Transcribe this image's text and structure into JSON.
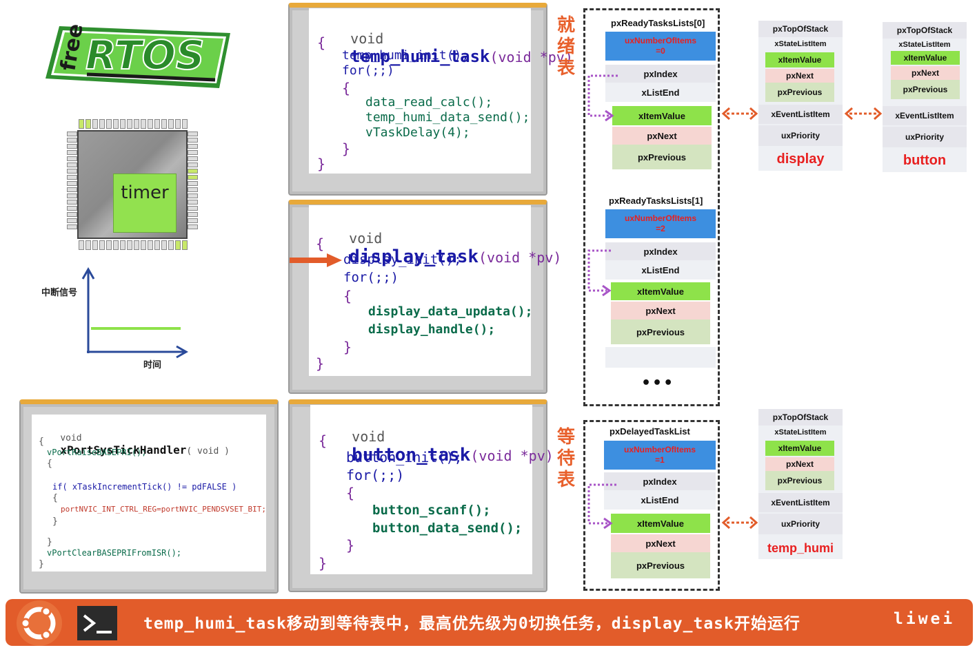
{
  "logo": {
    "free": "free",
    "rtos": "RTOS"
  },
  "chip": {
    "label": "timer"
  },
  "interrupt_plot": {
    "ylabel": "中断信号",
    "xlabel": "时间"
  },
  "tasks": {
    "temp_humi": {
      "signature_void": "void",
      "name": "temp_humi_task",
      "param": "(void *pv)",
      "lines": [
        "temp_humi_init();",
        "for(;;)",
        "data_read_calc();",
        "temp_humi_data_send();",
        "vTaskDelay(4);"
      ]
    },
    "display": {
      "signature_void": "void",
      "name": "display_task",
      "param": "(void *pv)",
      "lines": [
        "display_init();",
        "for(;;)",
        "display_data_updata();",
        "display_handle();"
      ]
    },
    "button": {
      "signature_void": "void",
      "name": "button_task",
      "param": "(void *pv)",
      "lines": [
        "button_init();",
        "for(;;)",
        "button_scanf();",
        "button_data_send();"
      ]
    },
    "systick": {
      "signature_void": "void",
      "name": "xPortSysTickHandler",
      "param": "( void )",
      "lines": [
        "vPortRaiseBASEPRI();",
        "if( xTaskIncrementTick() != pdFALSE )",
        "portNVIC_INT_CTRL_REG=portNVIC_PENDSVSET_BIT;",
        "vPortClearBASEPRIFromISR();"
      ]
    }
  },
  "labels": {
    "ready": [
      "就",
      "绪",
      "表"
    ],
    "delayed": [
      "等",
      "待",
      "表"
    ]
  },
  "lists": {
    "ready0": {
      "title": "pxReadyTasksLists[0]",
      "count_label": "uxNumberOfItems",
      "count": "=0"
    },
    "ready1": {
      "title": "pxReadyTasksLists[1]",
      "count_label": "uxNumberOfItems",
      "count": "=2"
    },
    "delayed": {
      "title": "pxDelayedTaskList",
      "count_label": "uxNumberOfItems",
      "count": "=1"
    },
    "fields": {
      "index": "pxIndex",
      "end": "xListEnd",
      "value": "xItemValue",
      "next": "pxNext",
      "prev": "pxPrevious"
    },
    "ellipsis": "•••"
  },
  "tcb": {
    "fields": {
      "top": "pxTopOfStack",
      "state": "xStateListItem",
      "value": "xItemValue",
      "next": "pxNext",
      "prev": "pxPrevious",
      "event": "xEventListItem",
      "priority": "uxPriority"
    },
    "names": {
      "display": "display",
      "button": "button",
      "temp_humi": "temp_humi"
    }
  },
  "footer": {
    "message": "temp_humi_task移动到等待表中，最高优先级为0切换任务，display_task开始运行",
    "author": "liwei"
  },
  "colors": {
    "accent": "#e25c2a",
    "ready_blue": "#3d8fe0",
    "item_green": "#8ee24a",
    "title_red": "#e82020"
  }
}
